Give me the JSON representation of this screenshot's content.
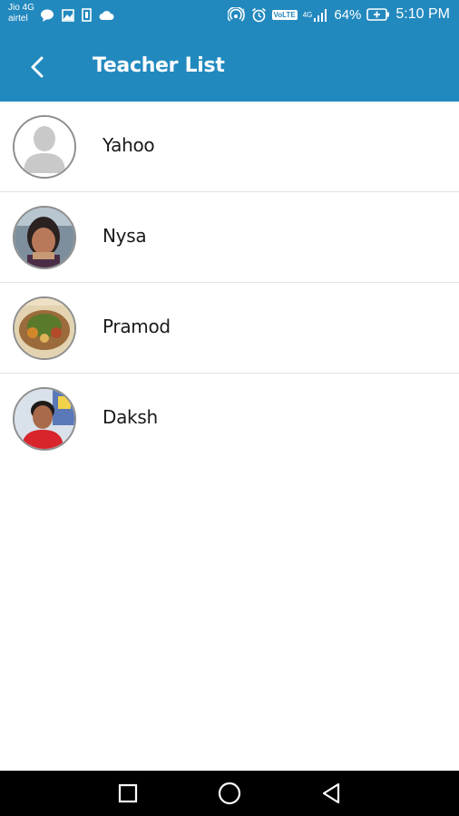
{
  "status_bar": {
    "carrier_line1": "Jio 4G",
    "carrier_line2": "airtel",
    "volte": "VoLTE",
    "network": "4G",
    "battery": "64%",
    "time": "5:10 PM"
  },
  "app_bar": {
    "title": "Teacher List",
    "back_icon": "chevron-left-icon"
  },
  "teachers": [
    {
      "name": "Yahoo",
      "avatar": "default-avatar-icon"
    },
    {
      "name": "Nysa",
      "avatar": "photo"
    },
    {
      "name": "Pramod",
      "avatar": "photo"
    },
    {
      "name": "Daksh",
      "avatar": "photo"
    }
  ],
  "nav_bar": {
    "recents_icon": "square-icon",
    "home_icon": "circle-icon",
    "back_icon": "triangle-back-icon"
  },
  "colors": {
    "primary": "#2289bf",
    "divider": "#e3e3e3",
    "nav": "#000000"
  }
}
